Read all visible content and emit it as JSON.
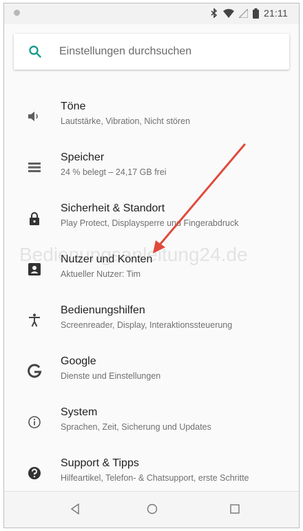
{
  "status_bar": {
    "time": "21:11"
  },
  "search": {
    "placeholder": "Einstellungen durchsuchen"
  },
  "items": [
    {
      "title": "Töne",
      "subtitle": "Lautstärke, Vibration, Nicht stören",
      "icon": "volume-icon"
    },
    {
      "title": "Speicher",
      "subtitle": "24 % belegt – 24,17 GB frei",
      "icon": "storage-icon"
    },
    {
      "title": "Sicherheit & Standort",
      "subtitle": "Play Protect, Displaysperre und Fingerabdruck",
      "icon": "lock-icon"
    },
    {
      "title": "Nutzer und Konten",
      "subtitle": "Aktueller Nutzer: Tim",
      "icon": "account-icon"
    },
    {
      "title": "Bedienungshilfen",
      "subtitle": "Screenreader, Display, Interaktionssteuerung",
      "icon": "accessibility-icon"
    },
    {
      "title": "Google",
      "subtitle": "Dienste und Einstellungen",
      "icon": "google-icon"
    },
    {
      "title": "System",
      "subtitle": "Sprachen, Zeit, Sicherung und Updates",
      "icon": "info-icon"
    },
    {
      "title": "Support & Tipps",
      "subtitle": "Hilfeartikel, Telefon- & Chatsupport, erste Schritte",
      "icon": "help-icon"
    }
  ],
  "watermark": "Bedienungsanleitung24.de",
  "colors": {
    "accent": "#1e9e8f",
    "annotation_arrow": "#e04a3c"
  }
}
